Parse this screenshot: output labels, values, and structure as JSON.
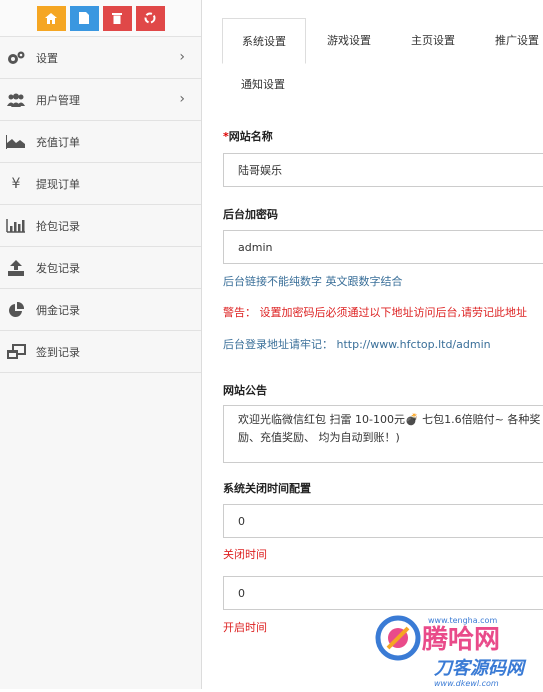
{
  "sidebar": {
    "shortcuts": [
      {
        "icon": "home-icon",
        "color": "#f5a623"
      },
      {
        "icon": "document-icon",
        "color": "#3a97e0"
      },
      {
        "icon": "trash-icon",
        "color": "#e04848"
      },
      {
        "icon": "recycle-icon",
        "color": "#e04848"
      }
    ],
    "items": [
      {
        "label": "设置",
        "has_arrow": true
      },
      {
        "label": "用户管理",
        "has_arrow": true
      },
      {
        "label": "充值订单"
      },
      {
        "label": "提现订单"
      },
      {
        "label": "抢包记录"
      },
      {
        "label": "发包记录"
      },
      {
        "label": "佣金记录"
      },
      {
        "label": "签到记录"
      }
    ],
    "yen_glyph": "¥"
  },
  "tabs": [
    "系统设置",
    "游戏设置",
    "主页设置",
    "推广设置",
    "通知设置"
  ],
  "form": {
    "site_name_label": "网站名称",
    "required_mark": "*",
    "site_name_value": "陆哥娱乐",
    "admin_pwd_label": "后台加密码",
    "admin_pwd_value": "admin",
    "admin_pwd_help": "后台链接不能纯数字 英文跟数字结合",
    "warning": "警告： 设置加密码后必须通过以下地址访问后台,请劳记此地址",
    "admin_url_note": "后台登录地址请牢记： http://www.hfctop.ltd/admin",
    "notice_label": "网站公告",
    "notice_text": "欢迎光临微信红包 扫雷  10-100元💣 七包1.6倍赔付~ 各种奖励、充值奖励、 均为自动到账！)",
    "close_time_label": "系统关闭时间配置",
    "close_time_value": "0",
    "close_time_sub": "关闭时间",
    "open_time_value": "0",
    "open_time_sub": "开启时间"
  },
  "watermark": {
    "brand": "腾哈网",
    "url": "www.tengha.com",
    "brand2": "刀客源码网",
    "url2": "www.dkewl.com"
  }
}
